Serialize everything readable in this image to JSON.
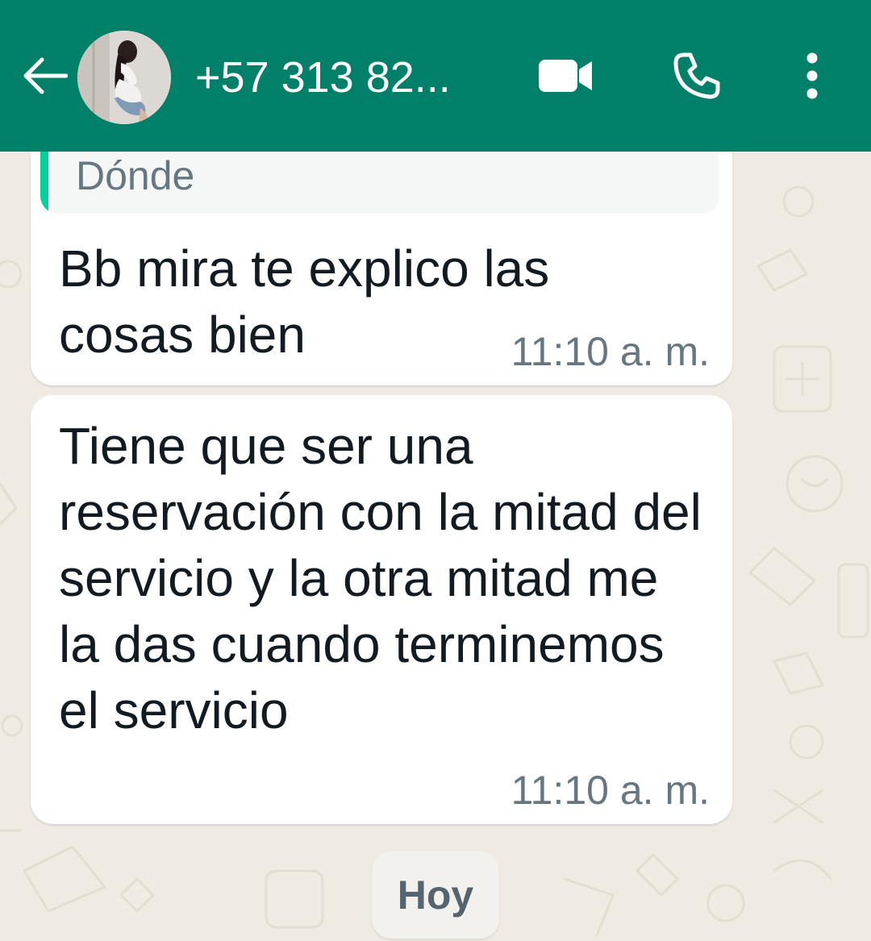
{
  "header": {
    "contact_name": "+57 313 82...",
    "background_color": "#008069",
    "icons": {
      "back": "arrow-left-icon",
      "video": "video-camera-icon",
      "call": "phone-icon",
      "menu": "more-vertical-icon"
    }
  },
  "messages": [
    {
      "quoted_text": "Dónde",
      "text": "Bb mira te explico las cosas bien",
      "time": "11:10 a. m."
    },
    {
      "text": "Tiene que ser una reservación con la mitad del servicio y la otra mitad me la das cuando terminemos el servicio",
      "time": "11:10 a. m."
    }
  ],
  "date_divider": "Hoy",
  "colors": {
    "chat_background": "#efeae2",
    "bubble": "#ffffff",
    "quote_accent": "#06cf9c",
    "time_text": "#667781",
    "message_text": "#111b21"
  }
}
